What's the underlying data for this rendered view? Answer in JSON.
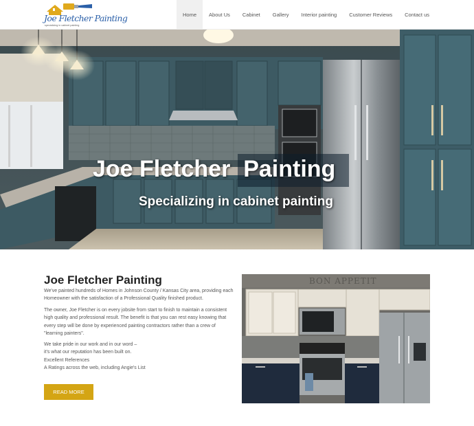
{
  "brand": {
    "logo_name": "Joe Fletcher Painting",
    "logo_tagline": "specializing in cabinet painting"
  },
  "nav": {
    "items": [
      {
        "label": "Home",
        "active": true
      },
      {
        "label": "About Us",
        "active": false
      },
      {
        "label": "Cabinet",
        "active": false
      },
      {
        "label": "Gallery",
        "active": false
      },
      {
        "label": "Interior painting",
        "active": false
      },
      {
        "label": "Customer Reviews",
        "active": false
      },
      {
        "label": "Contact us",
        "active": false
      }
    ]
  },
  "hero": {
    "title_part1": "Joe Fletcher",
    "title_part2": "Painting",
    "subtitle": "Specializing in cabinet painting"
  },
  "about": {
    "title": "Joe Fletcher Painting",
    "paragraph1": "We've painted hundreds of Homes in Johnson County / Kansas City area, providing each Homeowner with the satisfaction of a Professional Quality finished product.",
    "paragraph2": "The owner, Joe Fletcher is on every jobsite from start to finish to maintain a consistent high quality and professional result.  The benefit is that you can rest easy knowing that every step will be done by experienced painting contractors rather than a crew of \"learning painters\".",
    "lines": [
      "We take pride in our work and in our word –",
      "it's what our reputation has been built on.",
      "Excellent References",
      "A Ratings across the web, including Angie's List"
    ],
    "button_label": "READ MORE"
  },
  "photo": {
    "wall_text": "BON APPETIT"
  },
  "colors": {
    "accent": "#d4a514",
    "cabinet_teal": "#3d5a63",
    "nav_active_bg": "#f0f0f0",
    "logo_blue": "#2a5fa8"
  }
}
